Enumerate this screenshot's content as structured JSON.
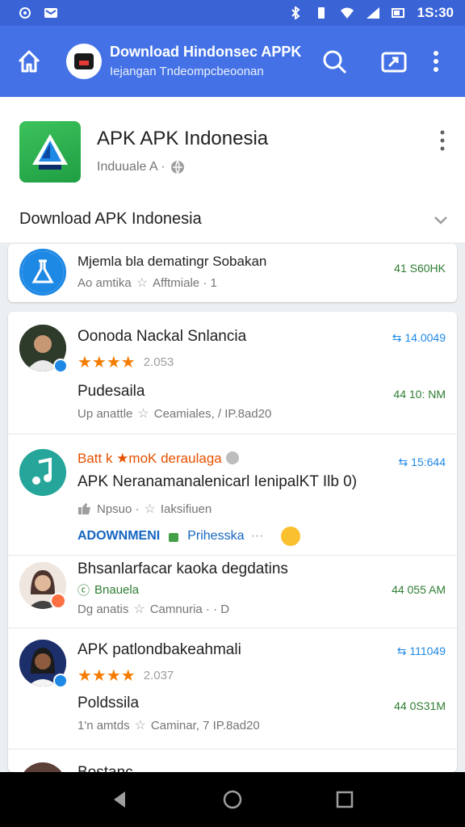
{
  "status": {
    "time": "1S:30"
  },
  "appbar": {
    "title": "Download Hindonsec APPK",
    "subtitle": "Iejangan   Tndeompcbeoonan"
  },
  "header": {
    "name": "APK APK Indonesia",
    "meta": "Induuale A ·",
    "section": "Download APK Indonesia"
  },
  "items": [
    {
      "title": "Mjemla bla dematingr Sobakan",
      "sub": "Ao amtika",
      "sub2": "Afftmiale · 1",
      "right": "41 S60HK"
    },
    {
      "title": "Oonoda Nackal Snlancia",
      "rating": "2.053",
      "title2": "Pudesaila",
      "sub": "Up anattle",
      "sub2": "Ceamiales, / IP.8ad20",
      "right_top": "14.0049",
      "right": "44 10: NM"
    },
    {
      "title": "Batt k ★moK deraulaga",
      "title2": "APK Neranamanalenicarl IenipalKT Ilb 0)",
      "sub": "Npsuo ·",
      "sub2": "Iaksifiuen",
      "link": "ADOWNMENI",
      "link2": "Prihesska",
      "right_top": "15:644"
    },
    {
      "title": "Bhsanlarfacar kaoka degdatins",
      "sub": "Bnauela",
      "sub_b": "Dg anatis",
      "sub2": "Camnuria · · D",
      "right": "44 055 AM"
    },
    {
      "title": "APK patlondbakeahmali",
      "rating": "2.037",
      "title2": "Poldssila",
      "sub": "1'n amtds",
      "sub2": "Caminar, 7 IP.8ad20",
      "right_top": "111049",
      "right": "44 0S31M"
    },
    {
      "title": "Bostanc"
    }
  ],
  "colors": {
    "appbar": "#4472e6",
    "statusbar": "#3a63d6",
    "green": "#2e7d32",
    "star": "#f57c00",
    "accent_orange": "#e65100"
  }
}
